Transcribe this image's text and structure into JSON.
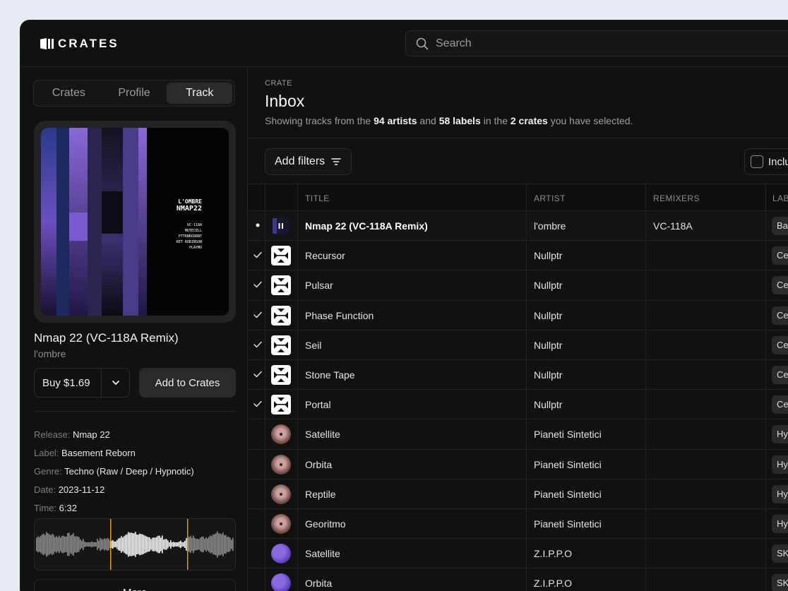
{
  "brand": {
    "name": "CRATES"
  },
  "search": {
    "placeholder": "Search"
  },
  "sidebar": {
    "tabs": [
      {
        "label": "Crates",
        "active": false
      },
      {
        "label": "Profile",
        "active": false
      },
      {
        "label": "Track",
        "active": true
      }
    ],
    "cover_text": {
      "artist": "L'OMBRE",
      "release": "NMAP22",
      "credits": [
        "VC-118A",
        "MUTECELL",
        "PTTRNRCRRNT",
        "KET ROBINSON",
        "PLAYMO"
      ]
    },
    "track": {
      "title": "Nmap 22 (VC-118A Remix)",
      "artist": "l'ombre",
      "buy_label": "Buy $1.69",
      "add_label": "Add to Crates"
    },
    "meta": {
      "release_key": "Release:",
      "release": "Nmap 22",
      "label_key": "Label:",
      "label": "Basement Reborn",
      "genre_key": "Genre:",
      "genre": "Techno (Raw / Deep / Hypnotic)",
      "date_key": "Date:",
      "date": "2023-11-12",
      "time_key": "Time:",
      "time": "6:32"
    },
    "more_label": "More"
  },
  "main": {
    "crumb": "CRATE",
    "title": "Inbox",
    "subtitle": {
      "p1": "Showing tracks from the ",
      "artists": "94 artists",
      "p2": " and ",
      "labels": "58 labels",
      "p3": " in the ",
      "crates": "2 crates",
      "p4": " you have selected."
    },
    "filters_label": "Add filters",
    "include_label": "Inclu"
  },
  "table": {
    "headers": {
      "title": "TITLE",
      "artist": "ARTIST",
      "remixers": "REMIXERS",
      "label": "LAB"
    },
    "rows": [
      {
        "status": "playing",
        "art": "cover-dark",
        "title": "Nmap 22 (VC-118A Remix)",
        "artist": "l'ombre",
        "remixers": "VC-118A",
        "label": "Ba"
      },
      {
        "status": "done",
        "art": "white-square",
        "title": "Recursor",
        "artist": "Nullptr",
        "remixers": "",
        "label": "Ce"
      },
      {
        "status": "done",
        "art": "white-square",
        "title": "Pulsar",
        "artist": "Nullptr",
        "remixers": "",
        "label": "Ce"
      },
      {
        "status": "done",
        "art": "white-square",
        "title": "Phase Function",
        "artist": "Nullptr",
        "remixers": "",
        "label": "Ce"
      },
      {
        "status": "done",
        "art": "white-square",
        "title": "Seil",
        "artist": "Nullptr",
        "remixers": "",
        "label": "Ce"
      },
      {
        "status": "done",
        "art": "white-square",
        "title": "Stone Tape",
        "artist": "Nullptr",
        "remixers": "",
        "label": "Ce"
      },
      {
        "status": "done",
        "art": "white-square",
        "title": "Portal",
        "artist": "Nullptr",
        "remixers": "",
        "label": "Ce"
      },
      {
        "status": "",
        "art": "pink-disc",
        "title": "Satellite",
        "artist": "Pianeti Sintetici",
        "remixers": "",
        "label": "Hy"
      },
      {
        "status": "",
        "art": "pink-disc",
        "title": "Orbita",
        "artist": "Pianeti Sintetici",
        "remixers": "",
        "label": "Hy"
      },
      {
        "status": "",
        "art": "pink-disc",
        "title": "Reptile",
        "artist": "Pianeti Sintetici",
        "remixers": "",
        "label": "Hy"
      },
      {
        "status": "",
        "art": "pink-disc",
        "title": "Georitmo",
        "artist": "Pianeti Sintetici",
        "remixers": "",
        "label": "Hy"
      },
      {
        "status": "",
        "art": "purple-disc",
        "title": "Satellite",
        "artist": "Z.I.P.P.O",
        "remixers": "",
        "label": "SK"
      },
      {
        "status": "",
        "art": "purple-disc",
        "title": "Orbita",
        "artist": "Z.I.P.P.O",
        "remixers": "",
        "label": "SK"
      }
    ]
  },
  "colors": {
    "background": "#e8ebf1",
    "panel": "#111112",
    "playhead": "#f0a500"
  }
}
